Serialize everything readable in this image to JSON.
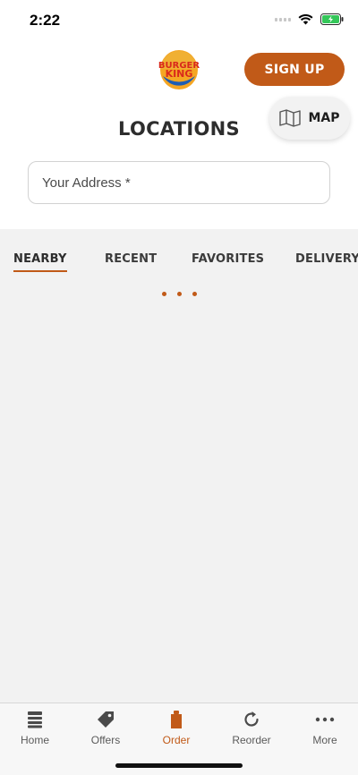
{
  "status_bar": {
    "time": "2:22"
  },
  "header": {
    "logo_text_line1": "BURGER",
    "logo_text_line2": "KING",
    "signup_label": "SIGN UP",
    "title": "LOCATIONS",
    "map_label": "MAP"
  },
  "address": {
    "placeholder": "Your Address *"
  },
  "tabs": [
    {
      "label": "NEARBY",
      "active": true
    },
    {
      "label": "RECENT",
      "active": false
    },
    {
      "label": "FAVORITES",
      "active": false
    },
    {
      "label": "DELIVERY",
      "active": false
    }
  ],
  "bottom_nav": [
    {
      "label": "Home",
      "icon": "home-icon"
    },
    {
      "label": "Offers",
      "icon": "tag-icon"
    },
    {
      "label": "Order",
      "icon": "bag-icon",
      "active": true
    },
    {
      "label": "Reorder",
      "icon": "reorder-icon"
    },
    {
      "label": "More",
      "icon": "more-icon"
    }
  ],
  "colors": {
    "accent": "#c15a18",
    "background": "#f2f2f2",
    "text": "#2d2d2d"
  }
}
